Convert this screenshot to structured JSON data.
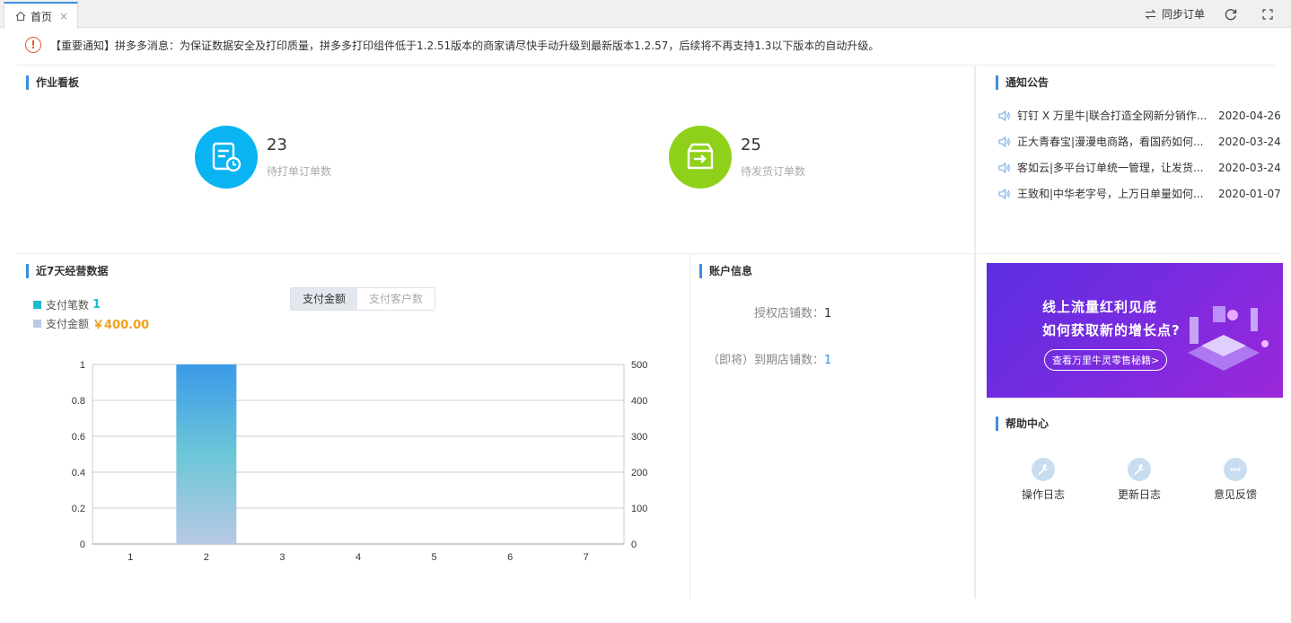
{
  "tabs": {
    "home_label": "首页",
    "close_label": "×"
  },
  "toolbar": {
    "sync_label": "同步订单"
  },
  "notice": {
    "text": "【重要通知】拼多多消息：为保证数据安全及打印质量，拼多多打印组件低于1.2.51版本的商家请尽快手动升级到最新版本1.2.57，后续将不再支持1.3以下版本的自动升级。"
  },
  "job_board": {
    "title": "作业看板",
    "pending_print": {
      "count": "23",
      "label": "待打单订单数",
      "color": "#0ab4f2"
    },
    "pending_ship": {
      "count": "25",
      "label": "待发货订单数",
      "color": "#8fd11a"
    }
  },
  "announcements": {
    "title": "通知公告",
    "items": [
      {
        "title": "钉钉 X 万里牛|联合打造全网新分销作...",
        "date": "2020-04-26"
      },
      {
        "title": "正大青春宝|漫漫电商路，看国药如何...",
        "date": "2020-03-24"
      },
      {
        "title": "客如云|多平台订单统一管理，让发货...",
        "date": "2020-03-24"
      },
      {
        "title": "王致和|中华老字号，上万日单量如何...",
        "date": "2020-01-07"
      }
    ]
  },
  "seven_day": {
    "title": "近7天经营数据",
    "legend_count_label": "支付笔数",
    "legend_count_value": "1",
    "legend_amount_label": "支付金额",
    "legend_amount_value": "￥400.00",
    "tab_amount": "支付金额",
    "tab_customers": "支付客户数"
  },
  "chart_data": {
    "type": "bar",
    "categories": [
      "1",
      "2",
      "3",
      "4",
      "5",
      "6",
      "7"
    ],
    "values": [
      0,
      1,
      0,
      0,
      0,
      0,
      0
    ],
    "ylim": [
      0,
      1
    ],
    "y_ticks": [
      "0",
      "0.2",
      "0.4",
      "0.6",
      "0.8",
      "1"
    ],
    "y2lim": [
      0,
      500
    ],
    "y2_ticks": [
      "0",
      "100",
      "200",
      "300",
      "400",
      "500"
    ],
    "grid": true,
    "colors": {
      "bar_top": "#3b9ae8",
      "bar_mid": "#6cc6d8",
      "bar_bottom": "#b8c9e4"
    }
  },
  "account": {
    "title": "账户信息",
    "authorized_label": "授权店铺数：",
    "authorized_value": "1",
    "expiring_label": "（即将）到期店铺数：",
    "expiring_value": "1"
  },
  "banner": {
    "line1": "线上流量红利见底",
    "line2": "如何获取新的增长点?",
    "button": "查看万里牛灵零售秘籍>"
  },
  "help_center": {
    "title": "帮助中心",
    "items": [
      {
        "label": "操作日志",
        "icon": "wrench-icon"
      },
      {
        "label": "更新日志",
        "icon": "wrench-icon"
      },
      {
        "label": "意见反馈",
        "icon": "chat-icon"
      }
    ]
  },
  "colors": {
    "accent": "#3b8fe0",
    "warning": "#e05a3a",
    "amount": "#f0a020",
    "count": "#1bbcd4"
  }
}
